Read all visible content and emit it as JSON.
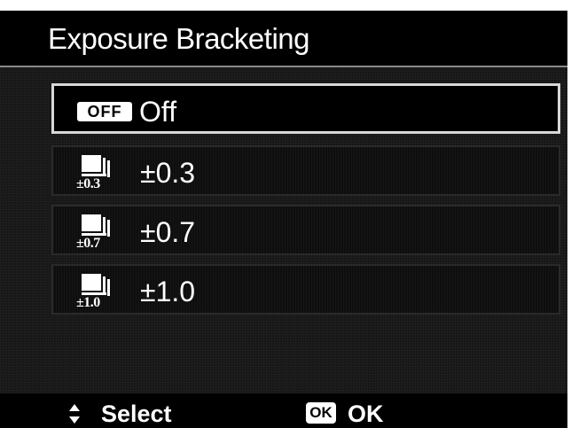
{
  "title": "Exposure Bracketing",
  "menu": {
    "selected_index": 0,
    "items": [
      {
        "icon": "off-badge-icon",
        "icon_text": "OFF",
        "label": "Off"
      },
      {
        "icon": "bracket-0.3-icon",
        "icon_text": "±0.3",
        "label": "±0.3"
      },
      {
        "icon": "bracket-0.7-icon",
        "icon_text": "±0.7",
        "label": "±0.7"
      },
      {
        "icon": "bracket-1.0-icon",
        "icon_text": "±1.0",
        "label": "±1.0"
      }
    ]
  },
  "footer": {
    "select_icon": "up-down-arrows-icon",
    "select_label": "Select",
    "ok_icon": "ok-button-icon",
    "ok_icon_text": "OK",
    "ok_label": "OK"
  },
  "colors": {
    "background": "#171717",
    "title_bar": "#000000",
    "text": "#ffffff",
    "selection_border": "#d8d8d8"
  }
}
